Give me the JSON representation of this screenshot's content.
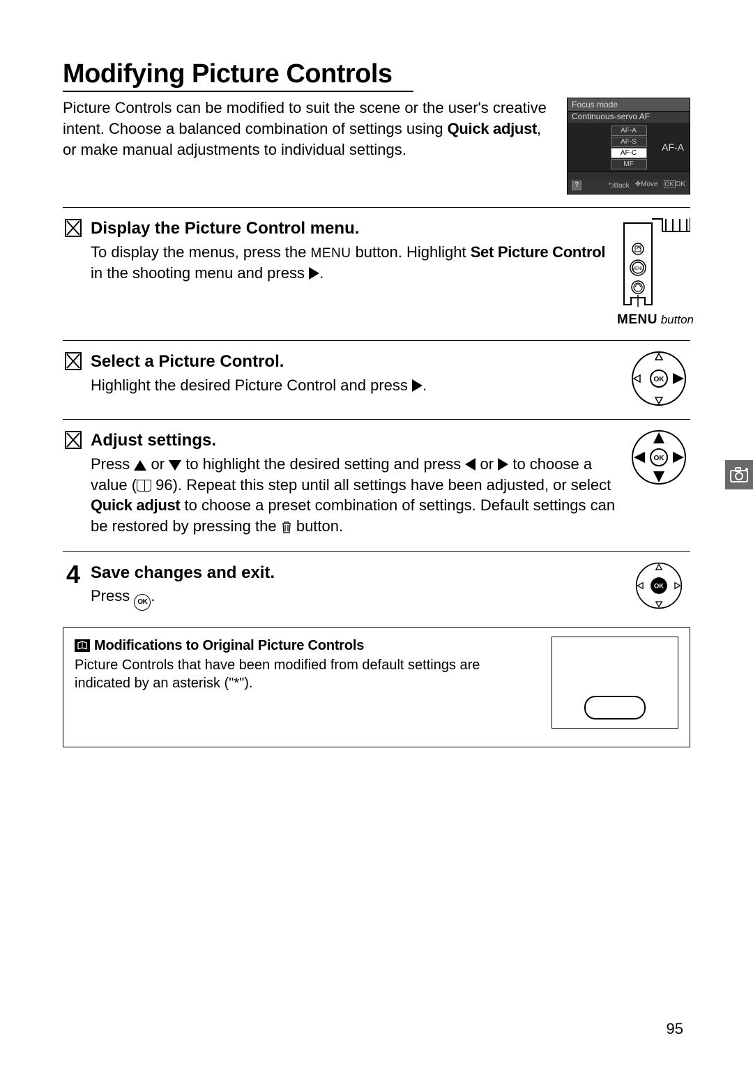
{
  "title": "Modifying Picture Controls",
  "intro": {
    "line1": "Picture Controls can be modified to suit the scene or the user's creative intent.  Choose a balanced combination of settings using ",
    "quick_adjust": "Quick adjust",
    "line2": ", or make manual adjustments to individual settings."
  },
  "lcd": {
    "header": "Focus mode",
    "sub": "Continuous-servo AF",
    "options": [
      "AF-A",
      "AF-S",
      "AF-C",
      "MF"
    ],
    "selected": "AF-C",
    "big": "AF-A",
    "foot_back": "Back",
    "foot_move": "Move",
    "foot_ok": "OK",
    "foot_okbox": "OK"
  },
  "steps": {
    "s1": {
      "title": "Display the Picture Control menu.",
      "p1": "To display the menus, press the ",
      "menu_word": "MENU",
      "p2": " button. Highlight ",
      "set_pc": "Set Picture Control",
      "p3": " in the shooting menu and press ",
      "caption_menu": "MENU",
      "caption_button": " button"
    },
    "s2": {
      "title": "Select a Picture Control.",
      "p1": "Highlight the desired Picture Control and press "
    },
    "s3": {
      "title": "Adjust settings.",
      "p1": "Press ",
      "p2": " or ",
      "p3": " to highlight the desired setting and press ",
      "p4": " or ",
      "p5": " to choose a value (",
      "pageref": " 96",
      "p6": "). Repeat this step until all settings have been adjusted, or select ",
      "quick_adjust": "Quick adjust",
      "p7": " to choose a preset combination of settings.  Default settings can be restored by pressing the ",
      "p8": " button."
    },
    "s4": {
      "num": "4",
      "title": "Save changes and exit.",
      "p1": "Press ",
      "ok": "OK",
      "p2": "."
    }
  },
  "note": {
    "title": "Modifications to Original Picture Controls",
    "body": "Picture Controls that have been modified from default settings are indicated by an asterisk (\"*\")."
  },
  "page_number": "95"
}
